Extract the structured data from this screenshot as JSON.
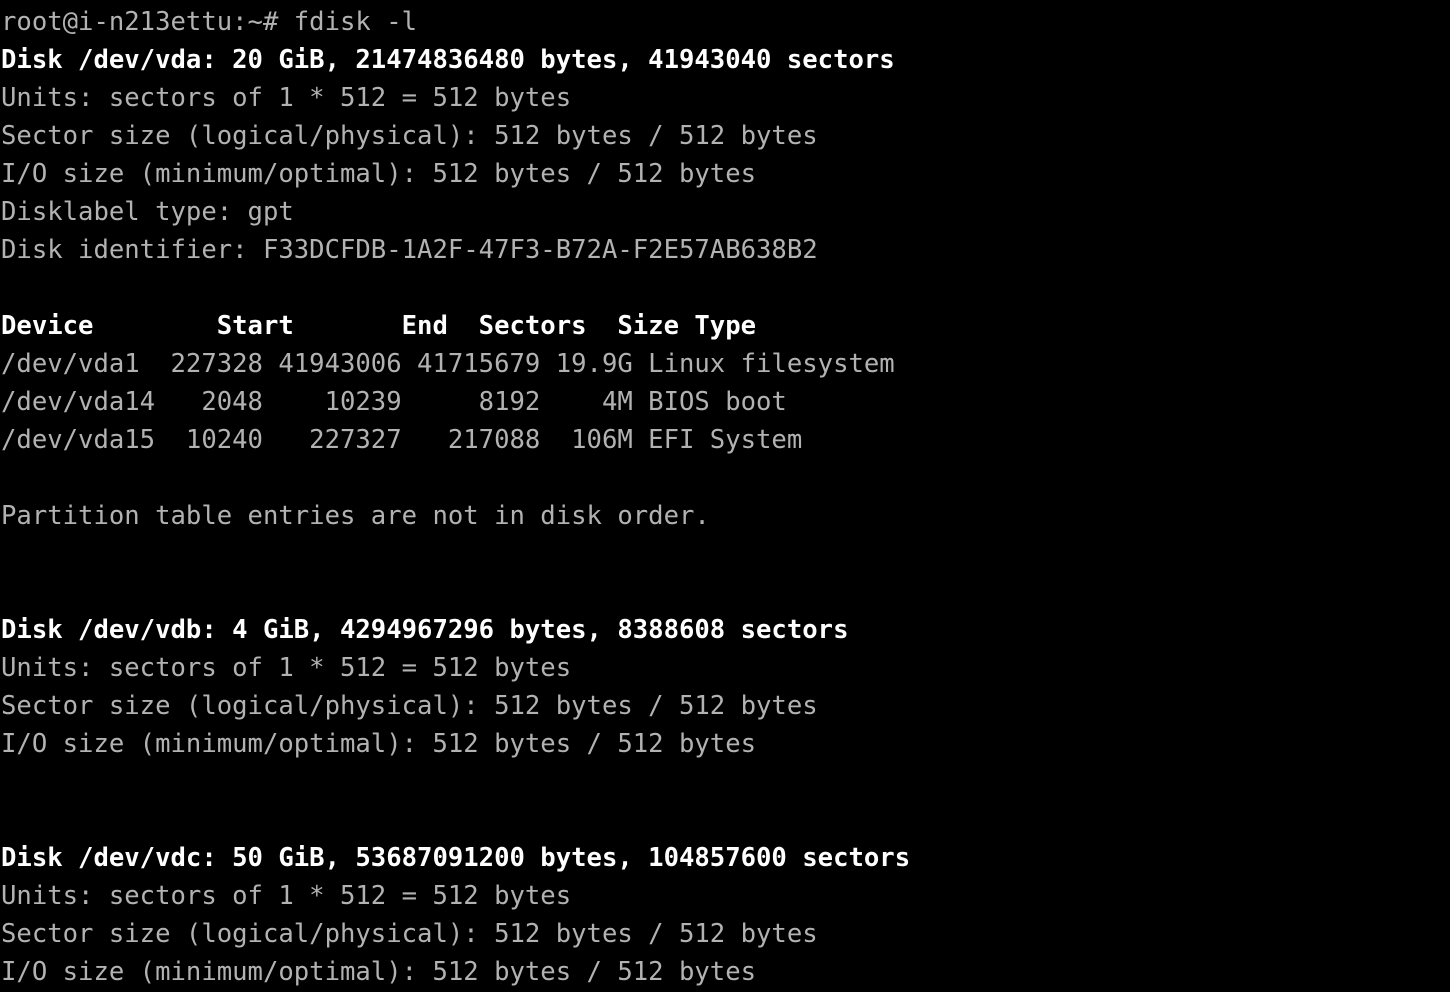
{
  "terminal": {
    "background_color": "#000000",
    "text_color": "#b2b2b2",
    "bold_color": "#ffffff",
    "prompt": "root@i-n213ettu:~# fdisk -l",
    "user": "root",
    "hostname": "i-n213ettu",
    "cwd": "~",
    "prompt_symbol": "#",
    "command": "fdisk -l"
  },
  "lines": [
    {
      "text": "root@i-n213ettu:~# fdisk -l",
      "bold": false,
      "name": "prompt-line"
    },
    {
      "text": "Disk /dev/vda: 20 GiB, 21474836480 bytes, 41943040 sectors",
      "bold": true,
      "name": "disk-header-vda"
    },
    {
      "text": "Units: sectors of 1 * 512 = 512 bytes",
      "bold": false,
      "name": "units-line-vda"
    },
    {
      "text": "Sector size (logical/physical): 512 bytes / 512 bytes",
      "bold": false,
      "name": "sector-size-line-vda"
    },
    {
      "text": "I/O size (minimum/optimal): 512 bytes / 512 bytes",
      "bold": false,
      "name": "io-size-line-vda"
    },
    {
      "text": "Disklabel type: gpt",
      "bold": false,
      "name": "disklabel-line-vda"
    },
    {
      "text": "Disk identifier: F33DCFDB-1A2F-47F3-B72A-F2E57AB638B2",
      "bold": false,
      "name": "disk-identifier-line-vda"
    },
    {
      "text": "",
      "bold": false,
      "name": "blank-line"
    },
    {
      "text": "Device        Start       End  Sectors  Size Type",
      "bold": true,
      "name": "partition-table-header"
    },
    {
      "text": "/dev/vda1  227328 41943006 41715679 19.9G Linux filesystem",
      "bold": false,
      "name": "partition-row-vda1"
    },
    {
      "text": "/dev/vda14   2048    10239     8192    4M BIOS boot",
      "bold": false,
      "name": "partition-row-vda14"
    },
    {
      "text": "/dev/vda15  10240   227327   217088  106M EFI System",
      "bold": false,
      "name": "partition-row-vda15"
    },
    {
      "text": "",
      "bold": false,
      "name": "blank-line"
    },
    {
      "text": "Partition table entries are not in disk order.",
      "bold": false,
      "name": "partition-order-notice"
    },
    {
      "text": "",
      "bold": false,
      "name": "blank-line"
    },
    {
      "text": "",
      "bold": false,
      "name": "blank-line"
    },
    {
      "text": "Disk /dev/vdb: 4 GiB, 4294967296 bytes, 8388608 sectors",
      "bold": true,
      "name": "disk-header-vdb"
    },
    {
      "text": "Units: sectors of 1 * 512 = 512 bytes",
      "bold": false,
      "name": "units-line-vdb"
    },
    {
      "text": "Sector size (logical/physical): 512 bytes / 512 bytes",
      "bold": false,
      "name": "sector-size-line-vdb"
    },
    {
      "text": "I/O size (minimum/optimal): 512 bytes / 512 bytes",
      "bold": false,
      "name": "io-size-line-vdb"
    },
    {
      "text": "",
      "bold": false,
      "name": "blank-line"
    },
    {
      "text": "",
      "bold": false,
      "name": "blank-line"
    },
    {
      "text": "Disk /dev/vdc: 50 GiB, 53687091200 bytes, 104857600 sectors",
      "bold": true,
      "name": "disk-header-vdc"
    },
    {
      "text": "Units: sectors of 1 * 512 = 512 bytes",
      "bold": false,
      "name": "units-line-vdc"
    },
    {
      "text": "Sector size (logical/physical): 512 bytes / 512 bytes",
      "bold": false,
      "name": "sector-size-line-vdc"
    },
    {
      "text": "I/O size (minimum/optimal): 512 bytes / 512 bytes",
      "bold": false,
      "name": "io-size-line-vdc"
    }
  ],
  "disks": [
    {
      "device": "/dev/vda",
      "size_human": "20 GiB",
      "size_bytes": "21474836480",
      "sectors": "41943040",
      "units": "sectors of 1 * 512 = 512 bytes",
      "sector_size_logical": "512 bytes",
      "sector_size_physical": "512 bytes",
      "io_size_minimum": "512 bytes",
      "io_size_optimal": "512 bytes",
      "disklabel_type": "gpt",
      "disk_identifier": "F33DCFDB-1A2F-47F3-B72A-F2E57AB638B2",
      "partition_table": {
        "columns": [
          "Device",
          "Start",
          "End",
          "Sectors",
          "Size",
          "Type"
        ],
        "rows": [
          {
            "device": "/dev/vda1",
            "start": "227328",
            "end": "41943006",
            "sectors": "41715679",
            "size": "19.9G",
            "type": "Linux filesystem"
          },
          {
            "device": "/dev/vda14",
            "start": "2048",
            "end": "10239",
            "sectors": "8192",
            "size": "4M",
            "type": "BIOS boot"
          },
          {
            "device": "/dev/vda15",
            "start": "10240",
            "end": "227327",
            "sectors": "217088",
            "size": "106M",
            "type": "EFI System"
          }
        ],
        "notice": "Partition table entries are not in disk order."
      }
    },
    {
      "device": "/dev/vdb",
      "size_human": "4 GiB",
      "size_bytes": "4294967296",
      "sectors": "8388608",
      "units": "sectors of 1 * 512 = 512 bytes",
      "sector_size_logical": "512 bytes",
      "sector_size_physical": "512 bytes",
      "io_size_minimum": "512 bytes",
      "io_size_optimal": "512 bytes"
    },
    {
      "device": "/dev/vdc",
      "size_human": "50 GiB",
      "size_bytes": "53687091200",
      "sectors": "104857600",
      "units": "sectors of 1 * 512 = 512 bytes",
      "sector_size_logical": "512 bytes",
      "sector_size_physical": "512 bytes",
      "io_size_minimum": "512 bytes",
      "io_size_optimal": "512 bytes"
    }
  ]
}
